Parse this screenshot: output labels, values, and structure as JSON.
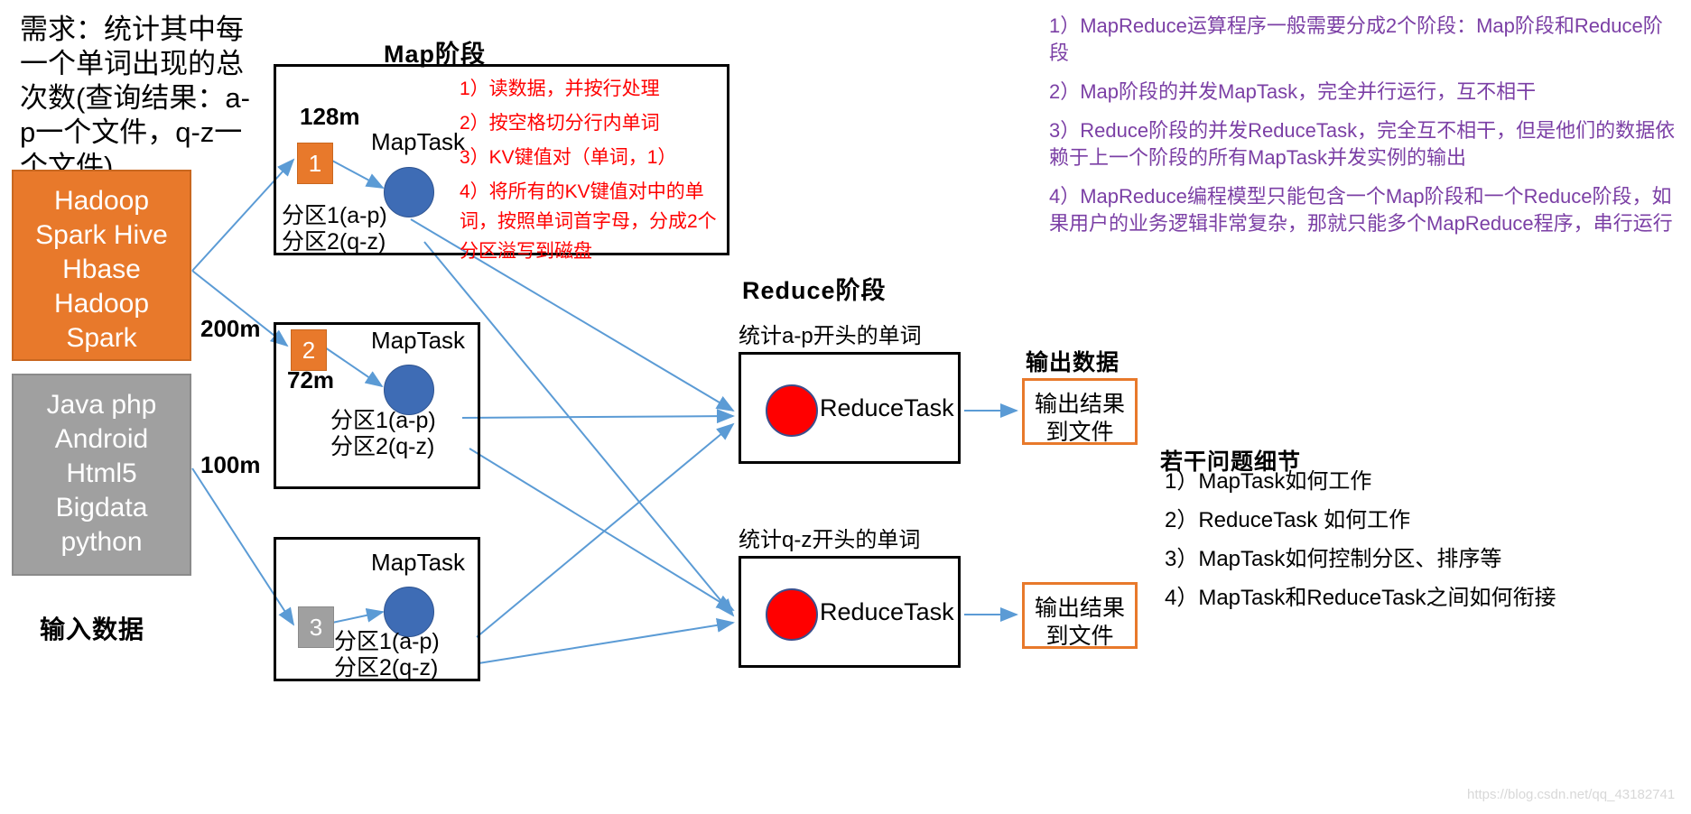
{
  "requirement": {
    "text": "需求：统计其中每一个单词出现的总次数(查询结果：a-p一个文件，q-z一个文件)"
  },
  "input": {
    "label": "输入数据",
    "blocks": [
      {
        "name": "orange-input-block",
        "color": "#E8792B",
        "text": "Hadoop\nSpark Hive\nHbase\nHadoop\nSpark\n…"
      },
      {
        "name": "gray-input-block",
        "color": "#A0A0A0",
        "text": "Java php\nAndroid\nHtml5\nBigdata\npython\n…"
      }
    ]
  },
  "sizes": {
    "s1": "128m",
    "s2": "200m",
    "s3": "72m",
    "s4": "100m"
  },
  "map_stage": {
    "title": "Map阶段",
    "tasks": [
      {
        "chunk": "1",
        "chunk_color": "#E8792B",
        "maptask_label": "MapTask",
        "partitions": "分区1(a-p)\n分区2(q-z)"
      },
      {
        "chunk": "2",
        "chunk_color": "#E8792B",
        "maptask_label": "MapTask",
        "partitions": "分区1(a-p)\n分区2(q-z)"
      },
      {
        "chunk": "3",
        "chunk_color": "#A0A0A0",
        "maptask_label": "MapTask",
        "partitions": "分区1(a-p)\n分区2(q-z)"
      }
    ],
    "steps": [
      "1）读数据，并按行处理",
      "2）按空格切分行内单词",
      "3）KV键值对（单词，1）",
      "4）将所有的KV键值对中的单词，按照单词首字母，分成2个分区溢写到磁盘"
    ],
    "steps_color": "#FF0000"
  },
  "reduce_stage": {
    "title": "Reduce阶段",
    "tasks": [
      {
        "caption": "统计a-p开头的单词",
        "label": "ReduceTask",
        "circle_color": "#FF0000"
      },
      {
        "caption": "统计q-z开头的单词",
        "label": "ReduceTask",
        "circle_color": "#FF0000"
      }
    ]
  },
  "output": {
    "label": "输出数据",
    "boxes": [
      "输出结果\n到文件",
      "输出结果\n到文件"
    ],
    "border_color": "#E8792B"
  },
  "notes_purple": {
    "color": "#7B3FA5",
    "items": [
      "1）MapReduce运算程序一般需要分成2个阶段：Map阶段和Reduce阶段",
      "2）Map阶段的并发MapTask，完全并行运行，互不相干",
      "3）Reduce阶段的并发ReduceTask，完全互不相干，但是他们的数据依赖于上一个阶段的所有MapTask并发实例的输出",
      "4）MapReduce编程模型只能包含一个Map阶段和一个Reduce阶段，如果用户的业务逻辑非常复杂，那就只能多个MapReduce程序，串行运行"
    ]
  },
  "notes_details": {
    "title": "若干问题细节",
    "items": [
      "1）MapTask如何工作",
      "2）ReduceTask 如何工作",
      "3）MapTask如何控制分区、排序等",
      "4）MapTask和ReduceTask之间如何衔接"
    ]
  },
  "watermark": "https://blog.csdn.net/qq_43182741",
  "colors": {
    "arrow": "#5B9BD5",
    "orange": "#E8792B",
    "gray": "#A0A0A0",
    "blue_circle": "#3E6CB5",
    "red": "#FF0000",
    "purple": "#7B3FA5"
  }
}
